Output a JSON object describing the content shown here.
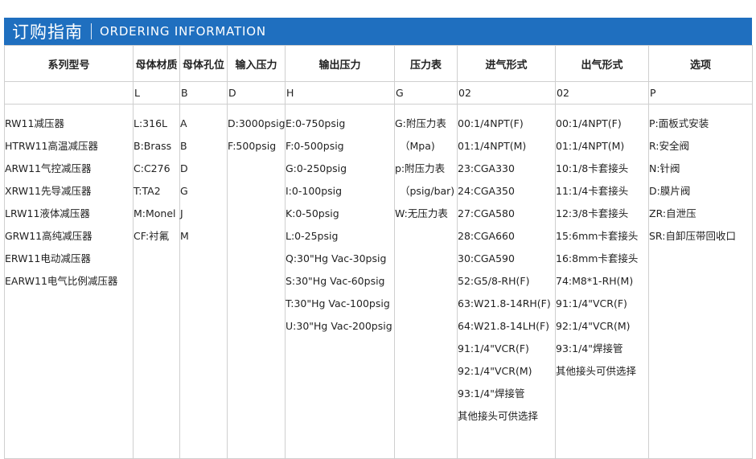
{
  "header": {
    "title_cn": "订购指南",
    "title_en": "ORDERING INFORMATION"
  },
  "columns": [
    "系列型号",
    "母体材质",
    "母体孔位",
    "输入压力",
    "输出压力",
    "压力表",
    "进气形式",
    "出气形式",
    "选项"
  ],
  "codes": [
    "",
    "L",
    "B",
    "D",
    "H",
    "G",
    "02",
    "02",
    "P"
  ],
  "series": [
    "RW11减压器",
    "HTRW11高温减压器",
    "ARW11气控减压器",
    "XRW11先导减压器",
    "LRW11液体减压器",
    "GRW11高纯减压器",
    "ERW11电动减压器",
    "EARW11电气比例减压器"
  ],
  "material": [
    "L:316L",
    "B:Brass",
    "C:C276",
    "T:TA2",
    "M:Monel",
    "CF:衬氟"
  ],
  "ports": [
    "A",
    "B",
    "D",
    "G",
    "J",
    "M"
  ],
  "inlet_pressure": [
    "D:3000psig",
    "F:500psig"
  ],
  "outlet_pressure": [
    "E:0-750psig",
    "F:0-500psig",
    "G:0-250psig",
    "I:0-100psig",
    "K:0-50psig",
    "L:0-25psig",
    "Q:30\"Hg Vac-30psig",
    "S:30\"Hg Vac-60psig",
    "T:30\"Hg Vac-100psig",
    "U:30\"Hg Vac-200psig"
  ],
  "gauge": [
    "G:附压力表",
    "（Mpa)",
    "p:附压力表",
    "（psig/bar)",
    "W:无压力表"
  ],
  "inlet_form": [
    "00:1/4NPT(F)",
    "01:1/4NPT(M)",
    "23:CGA330",
    "24:CGA350",
    "27:CGA580",
    "28:CGA660",
    "30:CGA590",
    "52:G5/8-RH(F)",
    "63:W21.8-14RH(F)",
    "64:W21.8-14LH(F)",
    "91:1/4\"VCR(F)",
    "92:1/4\"VCR(M)",
    "93:1/4\"焊接管",
    "其他接头可供选择"
  ],
  "outlet_form": [
    "00:1/4NPT(F)",
    "01:1/4NPT(M)",
    "10:1/8卡套接头",
    "11:1/4卡套接头",
    "12:3/8卡套接头",
    "15:6mm卡套接头",
    "16:8mm卡套接头",
    "74:M8*1-RH(M)",
    "91:1/4\"VCR(F)",
    "92:1/4\"VCR(M)",
    "93:1/4\"焊接管",
    "其他接头可供选择"
  ],
  "options": [
    "P:面板式安装",
    "R:安全阀",
    "N:针阀",
    "D:膜片阀",
    "ZR:自泄压",
    "SR:自卸压带回收口"
  ]
}
